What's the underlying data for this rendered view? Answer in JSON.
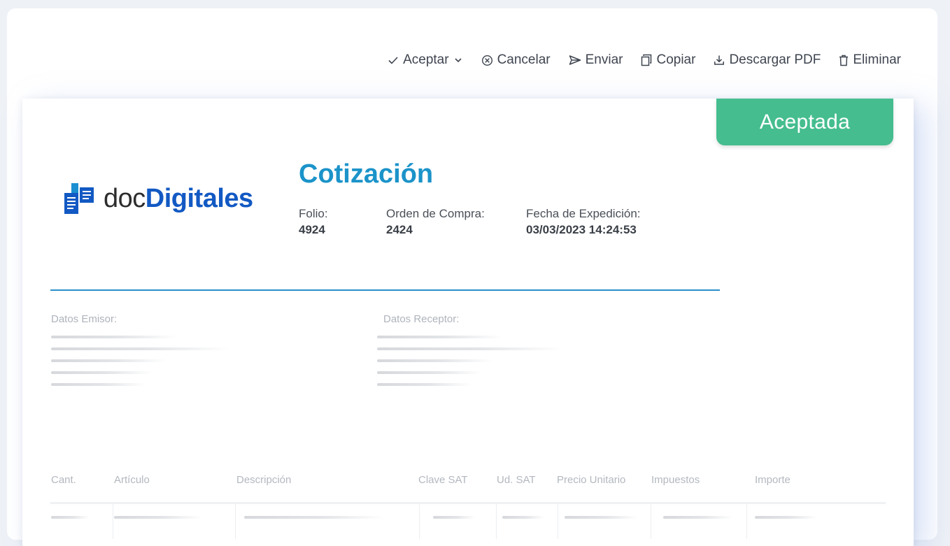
{
  "toolbar": {
    "accept_label": "Aceptar",
    "cancel_label": "Cancelar",
    "send_label": "Enviar",
    "copy_label": "Copiar",
    "download_label": "Descargar PDF",
    "delete_label": "Eliminar"
  },
  "status_badge": "Aceptada",
  "logo": {
    "prefix": "doc",
    "bold": "Digitales"
  },
  "document": {
    "title": "Cotización",
    "folio_label": "Folio:",
    "folio_value": "4924",
    "order_label": "Orden de Compra:",
    "order_value": "2424",
    "date_label": "Fecha de Expedición:",
    "date_value": "03/03/2023 14:24:53"
  },
  "parties": {
    "issuer_label": "Datos Emisor:",
    "receiver_label": "Datos Receptor:"
  },
  "table": {
    "columns": [
      "Cant.",
      "Artículo",
      "Descripción",
      "Clave SAT",
      "Ud. SAT",
      "Precio Unitario",
      "Impuestos",
      "Importe"
    ]
  },
  "colors": {
    "accent": "#1b93c9",
    "brand": "#1259c3",
    "status_accepted": "#45bd8f"
  },
  "icons": {
    "accept": "check-icon",
    "dropdown": "chevron-down-icon",
    "cancel": "circle-x-icon",
    "send": "send-icon",
    "copy": "copy-icon",
    "download": "download-icon",
    "delete": "trash-icon",
    "logo": "document-stack-icon"
  }
}
